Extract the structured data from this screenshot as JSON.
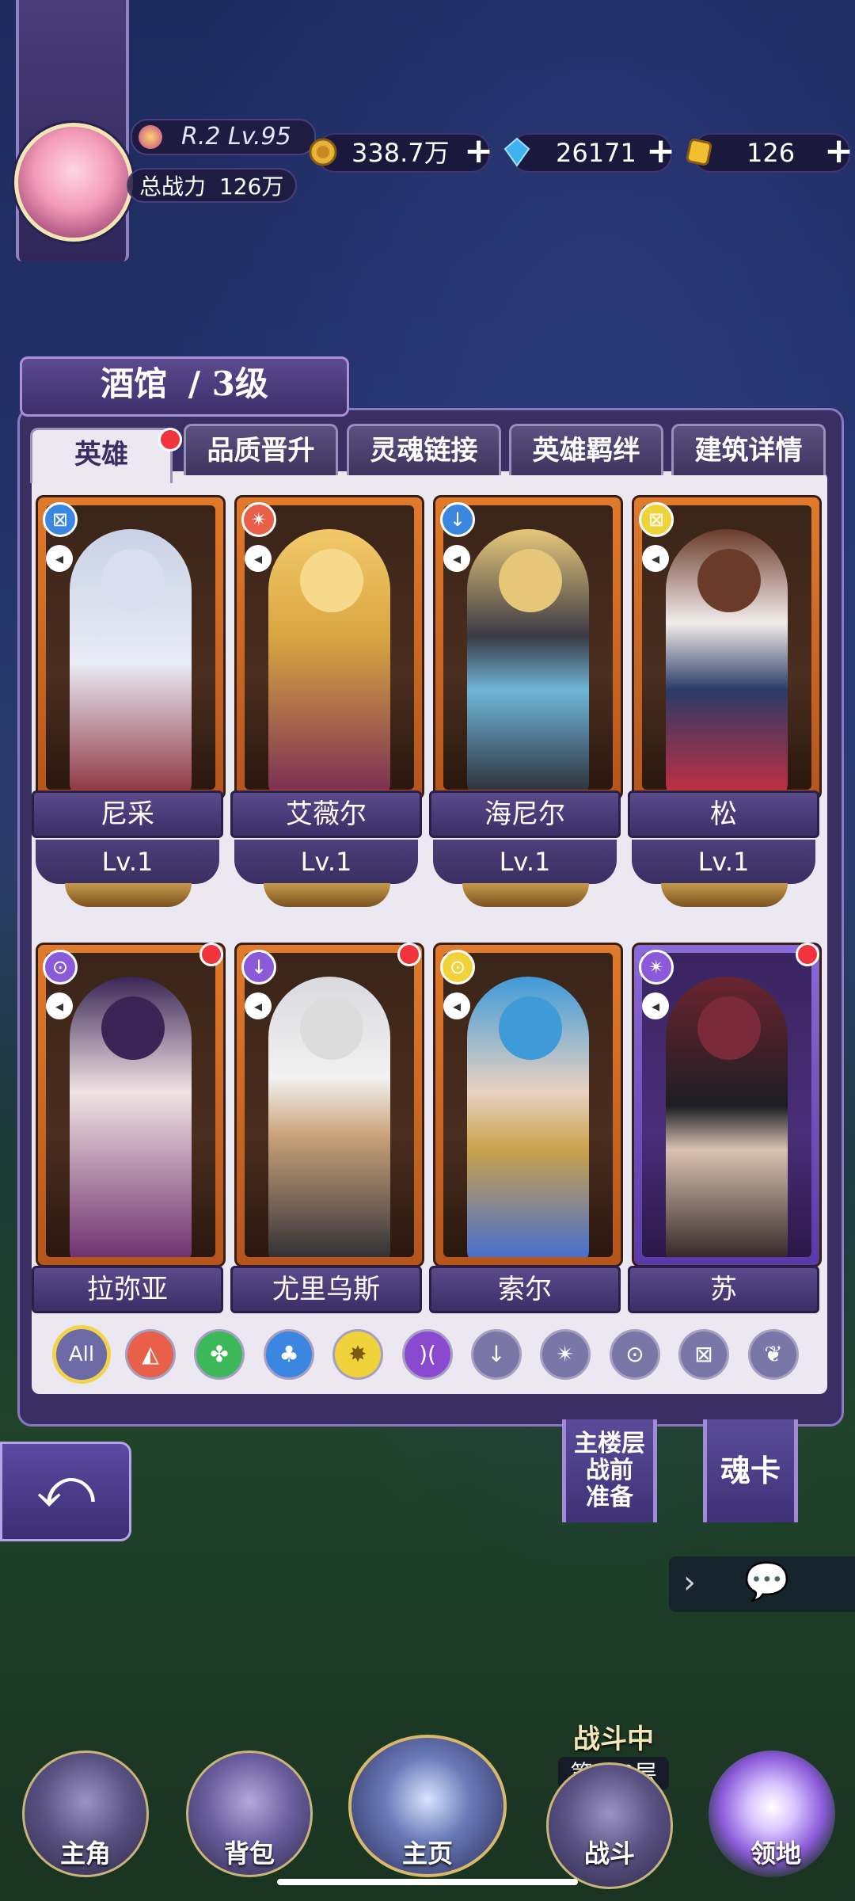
{
  "player": {
    "rank_level": "R.2 Lv.95",
    "power_label": "总战力",
    "power_value": "126万"
  },
  "resources": [
    {
      "name": "gold",
      "value": "338.7万",
      "icon": "gold-coin-icon",
      "color": "#e6b33b"
    },
    {
      "name": "diamond",
      "value": "26171",
      "icon": "crystal-icon",
      "color": "#3fb0f0"
    },
    {
      "name": "gem",
      "value": "126",
      "icon": "gold-gem-icon",
      "color": "#f0c030"
    }
  ],
  "tavern": {
    "title": "酒馆",
    "level": "/ 3级"
  },
  "tabs": [
    {
      "label": "英雄",
      "active": true,
      "badge": true
    },
    {
      "label": "品质晋升",
      "active": false
    },
    {
      "label": "灵魂链接",
      "active": false
    },
    {
      "label": "英雄羁绊",
      "active": false
    },
    {
      "label": "建筑详情",
      "active": false
    }
  ],
  "heroes": [
    {
      "name": "尼采",
      "level": "Lv.1",
      "element": "fan-icon",
      "element_color": "#3a86e0",
      "badge": false
    },
    {
      "name": "艾薇尔",
      "level": "Lv.1",
      "element": "shuriken-icon",
      "element_color": "#e8604a",
      "badge": false
    },
    {
      "name": "海尼尔",
      "level": "Lv.1",
      "element": "sword-icon",
      "element_color": "#3a86e0",
      "badge": false
    },
    {
      "name": "松",
      "level": "Lv.1",
      "element": "fan-icon",
      "element_color": "#f0d23a",
      "badge": false
    },
    {
      "name": "拉弥亚",
      "level": "",
      "element": "staff-icon",
      "element_color": "#8a5ad8",
      "badge": true
    },
    {
      "name": "尤里乌斯",
      "level": "",
      "element": "sword-icon",
      "element_color": "#8a5ad8",
      "badge": false
    },
    {
      "name": "索尔",
      "level": "",
      "element": "staff-icon",
      "element_color": "#f0d23a",
      "badge": true
    },
    {
      "name": "苏",
      "level": "",
      "element": "shuriken-icon",
      "element_color": "#8a5ad8",
      "badge": true
    }
  ],
  "filters": [
    {
      "label": "All",
      "icon": "all-filter",
      "color": "#6d6aa8"
    },
    {
      "label": "",
      "icon": "fire-element-icon",
      "color": "#e8604a"
    },
    {
      "label": "",
      "icon": "nature-element-icon",
      "color": "#3cb85a"
    },
    {
      "label": "",
      "icon": "water-element-icon",
      "color": "#3a86e0"
    },
    {
      "label": "",
      "icon": "light-element-icon",
      "color": "#f0d23a"
    },
    {
      "label": "",
      "icon": "dark-element-icon",
      "color": "#8a4ad0"
    },
    {
      "label": "",
      "icon": "sword-class-icon",
      "color": "#7b76a8"
    },
    {
      "label": "",
      "icon": "shuriken-class-icon",
      "color": "#7b76a8"
    },
    {
      "label": "",
      "icon": "staff-class-icon",
      "color": "#7b76a8"
    },
    {
      "label": "",
      "icon": "fan-class-icon",
      "color": "#7b76a8"
    },
    {
      "label": "",
      "icon": "wing-class-icon",
      "color": "#7b76a8"
    }
  ],
  "side_buttons": {
    "prep_label": "主楼层战前准备",
    "prep_line1": "主楼层",
    "prep_line2": "战前",
    "prep_line3": "准备",
    "soul_card_label": "魂卡"
  },
  "battle": {
    "status": "战斗中",
    "floor": "第190层"
  },
  "nav": [
    {
      "label": "主角",
      "icon": "hero-icon"
    },
    {
      "label": "背包",
      "icon": "bag-icon"
    },
    {
      "label": "主页",
      "icon": "book-icon"
    },
    {
      "label": "战斗",
      "icon": "crossed-swords-icon"
    },
    {
      "label": "领地",
      "icon": "castle-icon"
    }
  ]
}
